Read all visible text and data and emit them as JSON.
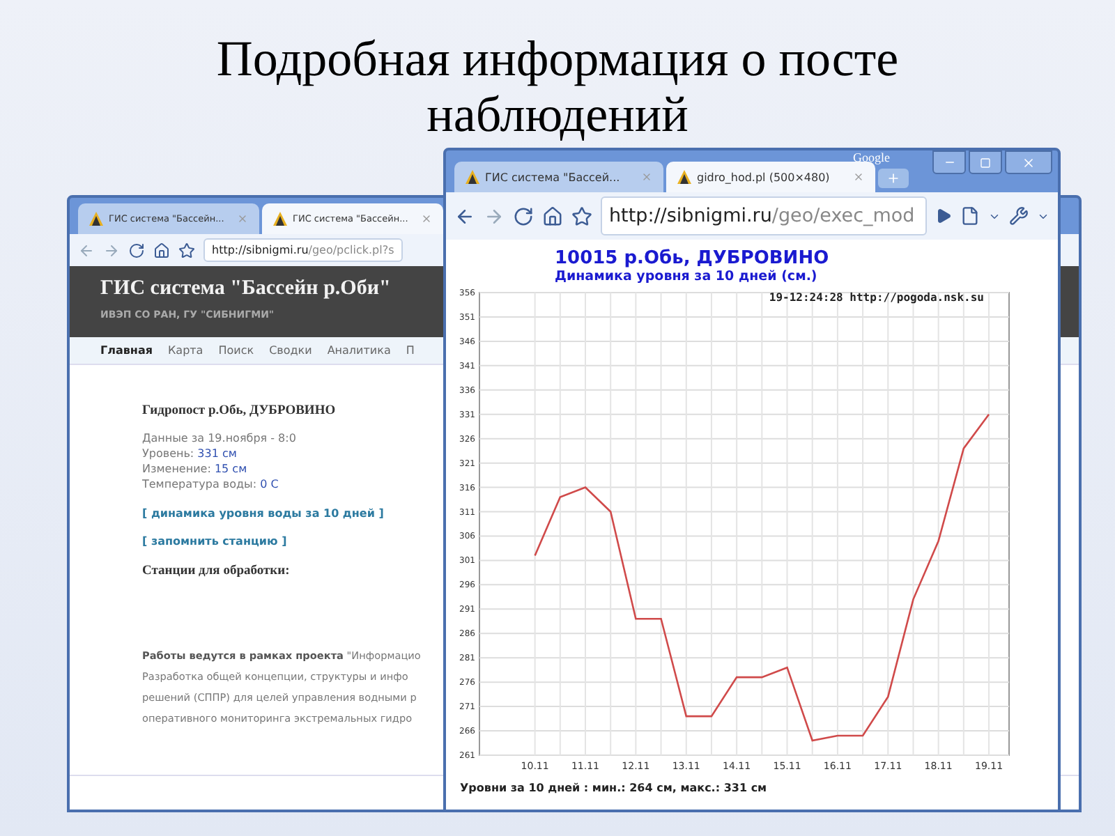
{
  "slide_title": "Подробная информация о посте наблюдений",
  "back_window": {
    "tabs": [
      {
        "label": "ГИС система \"Бассейн...",
        "selected": false
      },
      {
        "label": "ГИС система \"Бассейн...",
        "selected": true
      }
    ],
    "url": {
      "host": "http://sibnigmi.ru",
      "path": "/geo/pclick.pl?s"
    },
    "site_title": "ГИС система \"Бассейн р.Оби\"",
    "site_subtitle": "ИВЭП СО РАН, ГУ \"СИБНИГМИ\"",
    "nav": [
      {
        "label": "Главная",
        "selected": true
      },
      {
        "label": "Карта",
        "selected": false
      },
      {
        "label": "Поиск",
        "selected": false
      },
      {
        "label": "Сводки",
        "selected": false
      },
      {
        "label": "Аналитика",
        "selected": false
      },
      {
        "label": "П",
        "selected": false
      }
    ],
    "station_heading": "Гидропост р.Обь, ДУБРОВИНО",
    "data_lines": [
      {
        "label": "Данные за 19.ноября - 8:0"
      },
      {
        "label": "Уровень:",
        "value": "331 см"
      },
      {
        "label": "Изменение:",
        "value": "15 см"
      },
      {
        "label": "Температура воды:",
        "value": "0 С"
      }
    ],
    "links": [
      "[ динамика уровня воды за 10 дней ]",
      "[ запомнить станцию ]"
    ],
    "stations_heading": "Станции для обработки:",
    "project_lines": [
      "**Работы ведутся в рамках проекта** \"Информацио",
      "Разработка общей концепции, структуры и инфо",
      "решений (СППР) для целей управления водными р",
      "оперативного мониторинга экстремальных гидро"
    ]
  },
  "front_window": {
    "brand": "Google",
    "tabs": [
      {
        "label": "ГИС система \"Бассей...",
        "selected": false
      },
      {
        "label": "gidro_hod.pl (500×480)",
        "selected": true
      }
    ],
    "url": {
      "host": "http://sibnigmi.ru",
      "path": "/geo/exec_mod"
    },
    "title": "10015 р.Обь, ДУБРОВИНО",
    "subtitle": "Динамика уровня за 10 дней (см.)",
    "stamp": "19-12:24:28 http://pogoda.nsk.su",
    "chart_data": {
      "type": "line",
      "categories": [
        "10.11",
        null,
        "11.11",
        null,
        "12.11",
        null,
        "13.11",
        null,
        "14.11",
        null,
        "15.11",
        null,
        "16.11",
        null,
        "17.11",
        null,
        "18.11",
        null,
        "19.11"
      ],
      "series": [
        {
          "color": "#d04a4a",
          "values": [
            302,
            314,
            316,
            311,
            289,
            289,
            269,
            269,
            277,
            277,
            279,
            264,
            265,
            265,
            273,
            293,
            305,
            324,
            331
          ]
        }
      ],
      "ylim": [
        261,
        356
      ],
      "grid": true,
      "yticks": [
        261,
        266,
        271,
        276,
        281,
        286,
        291,
        296,
        301,
        306,
        311,
        316,
        321,
        326,
        331,
        336,
        341,
        346,
        351,
        356
      ]
    },
    "footer": "Уровни за 10 дней : мин.: 264 см, макс.: 331 см"
  }
}
